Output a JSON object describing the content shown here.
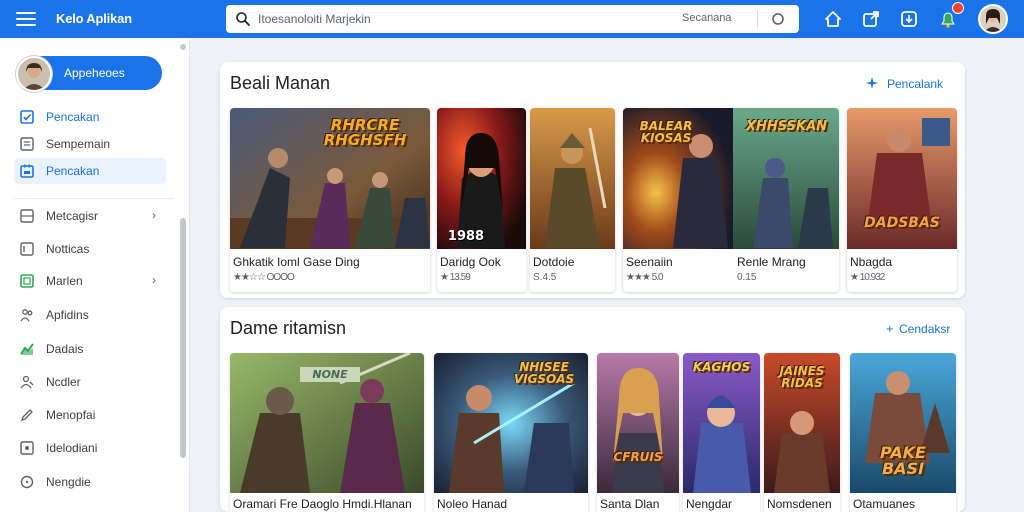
{
  "header": {
    "app_title": "Kelo Aplikan",
    "search_value": "Itoesanoloiti Marjekin",
    "search_button": "Secanana"
  },
  "sidebar": {
    "profile_label": "Appeheoes",
    "items": [
      {
        "label": "Pencakan",
        "active": true
      },
      {
        "label": "Sempemain"
      },
      {
        "label": "Pencakan",
        "active": true
      },
      {
        "label": "Metcagisr",
        "chevron": "›"
      },
      {
        "label": "Notticas"
      },
      {
        "label": "Marlen",
        "chevron": "›"
      },
      {
        "label": "Apfidins"
      },
      {
        "label": "Dadais"
      },
      {
        "label": "Ncdler"
      },
      {
        "label": "Menopfai"
      },
      {
        "label": "Idelodiani"
      },
      {
        "label": "Nengdie"
      }
    ]
  },
  "sections": [
    {
      "title": "Beali Manan",
      "link": "Pencalank",
      "cards": [
        {
          "title": "Ghkatik Ioml Gase Ding",
          "meta": "★★☆☆ OOOO",
          "art": "RHRCRE\nRHGHSFH"
        },
        {
          "title": "Daridg Ook",
          "meta": "★ 13.59",
          "art": "1988"
        },
        {
          "title": "Dotdoie",
          "meta": "S.4.5",
          "art": ""
        },
        {
          "title": "Seenaiin",
          "meta": "★★★ 5.0",
          "art": "BALEAR\nKIOSAS"
        },
        {
          "title": "Renle Mrang",
          "meta": "0.15",
          "art": "XHHSSKAN"
        },
        {
          "title": "Nbagda",
          "meta": "★ 10.932",
          "art": "DADSBAS"
        }
      ]
    },
    {
      "title": "Dame ritamisn",
      "link": "Cendaksr",
      "cards": [
        {
          "title": "Oramari Fre Daoglo Hmdi.Hlanan",
          "art": "NONE"
        },
        {
          "title": "Noleo Hanad",
          "art": "NHISEE\nVIGSOAS"
        },
        {
          "title": "Santa Dlan",
          "art": "CFRUIS"
        },
        {
          "title": "Nengdar",
          "art": "KAGHOS"
        },
        {
          "title": "Nomsdenen",
          "art": "JAINES\nRIDAS"
        },
        {
          "title": "Otamuanes",
          "art": "PAKE\nBASI"
        }
      ]
    }
  ],
  "colors": {
    "accent": "#1a73e8",
    "star": "#f9ab00",
    "notification": "#ea4335"
  }
}
